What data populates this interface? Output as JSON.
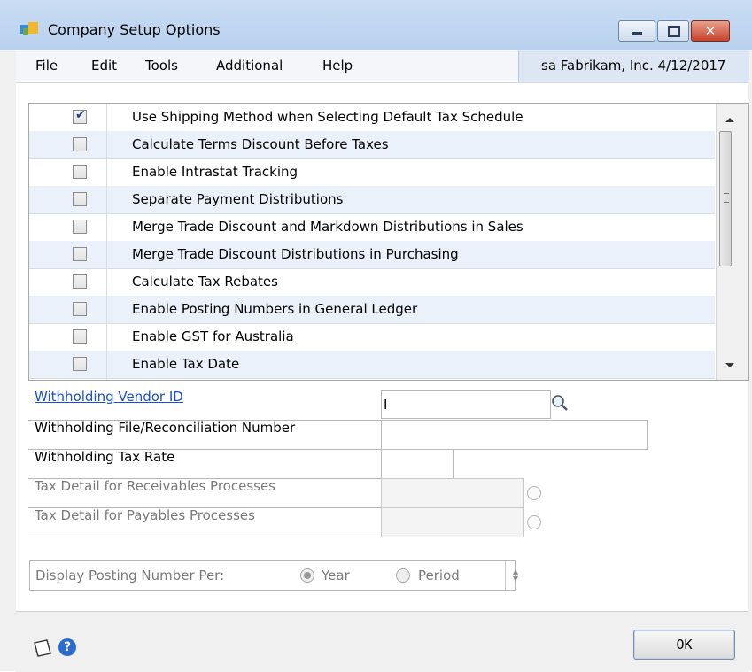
{
  "window": {
    "title": "Company Setup Options"
  },
  "menu": [
    "File",
    "Edit",
    "Tools",
    "Additional",
    "Help"
  ],
  "user_info": "sa  Fabrikam, Inc. 4/12/2017",
  "options": [
    {
      "label": "Use Shipping Method when Selecting Default Tax Schedule",
      "checked": true
    },
    {
      "label": "Calculate Terms Discount Before Taxes",
      "checked": false
    },
    {
      "label": "Enable Intrastat Tracking",
      "checked": false
    },
    {
      "label": "Separate Payment Distributions",
      "checked": false
    },
    {
      "label": "Merge Trade Discount and Markdown Distributions in Sales",
      "checked": false
    },
    {
      "label": "Merge Trade Discount Distributions in Purchasing",
      "checked": false
    },
    {
      "label": "Calculate Tax Rebates",
      "checked": false
    },
    {
      "label": "Enable Posting Numbers in General Ledger",
      "checked": false
    },
    {
      "label": "Enable GST for Australia",
      "checked": false
    },
    {
      "label": "Enable Tax Date",
      "checked": false
    }
  ],
  "fields": {
    "withholding_vendor_id": {
      "label": "Withholding Vendor ID",
      "value": "I"
    },
    "withholding_file_number": {
      "label": "Withholding File/Reconciliation Number",
      "value": ""
    },
    "withholding_tax_rate": {
      "label": "Withholding Tax Rate",
      "value": ""
    },
    "tax_detail_receivables": {
      "label": "Tax Detail for Receivables Processes",
      "value": ""
    },
    "tax_detail_payables": {
      "label": "Tax Detail for Payables Processes",
      "value": ""
    }
  },
  "posting": {
    "label": "Display Posting Number Per:",
    "options": [
      "Year",
      "Period"
    ],
    "selected": "Year"
  },
  "buttons": {
    "ok": "OK"
  },
  "icons": [
    "app-icon",
    "minimize-icon",
    "maximize-icon",
    "close-icon",
    "lookup-icon",
    "note-icon",
    "help-icon"
  ]
}
